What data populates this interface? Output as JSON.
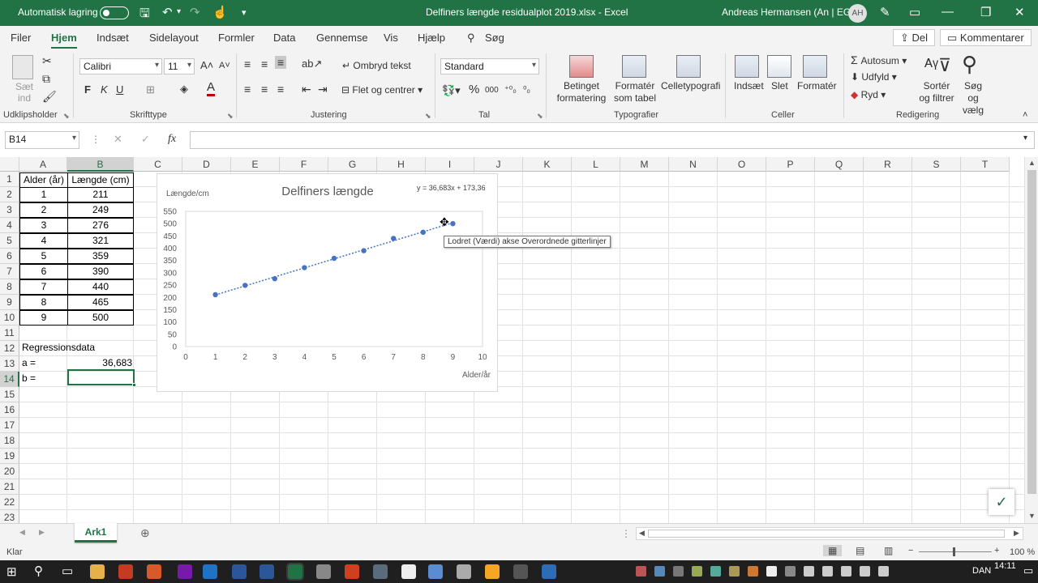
{
  "titlebar": {
    "autosave_label": "Automatisk lagring",
    "doc_title": "Delfiners længde residualplot 2019.xlsx  -  Excel",
    "user_name": "Andreas Hermansen (An | EG)",
    "user_initials": "AH"
  },
  "menu": {
    "tabs": [
      "Filer",
      "Hjem",
      "Indsæt",
      "Sidelayout",
      "Formler",
      "Data",
      "Gennemse",
      "Vis",
      "Hjælp",
      "Søg"
    ],
    "share_label": "Del",
    "comments_label": "Kommentarer"
  },
  "ribbon": {
    "clipboard": {
      "paste": "Sæt ind",
      "group": "Udklipsholder"
    },
    "font": {
      "name": "Calibri",
      "size": "11",
      "group": "Skrifttype",
      "bold": "F",
      "italic": "K",
      "underline": "U"
    },
    "alignment": {
      "wrap": "Ombryd tekst",
      "merge": "Flet og centrer",
      "group": "Justering"
    },
    "number": {
      "format": "Standard",
      "group": "Tal",
      "percent": "%",
      "thousands": "000"
    },
    "styles": {
      "conditional": "Betinget formatering",
      "table": "Formatér som tabel",
      "cellstyles": "Celletypografi",
      "group": "Typografier"
    },
    "cells": {
      "insert": "Indsæt",
      "delete": "Slet",
      "format": "Formatér",
      "group": "Celler"
    },
    "editing": {
      "autosum": "Autosum",
      "fill": "Udfyld",
      "clear": "Ryd",
      "sort": "Sortér og filtrer",
      "find": "Søg og vælg",
      "group": "Redigering"
    }
  },
  "formula_bar": {
    "name_box": "B14",
    "fx": "fx",
    "value": ""
  },
  "grid": {
    "columns": [
      "A",
      "B",
      "C",
      "D",
      "E",
      "F",
      "G",
      "H",
      "I",
      "J",
      "K",
      "L",
      "M",
      "N",
      "O",
      "P",
      "Q",
      "R",
      "S",
      "T"
    ],
    "rows": [
      "1",
      "2",
      "3",
      "4",
      "5",
      "6",
      "7",
      "8",
      "9",
      "10",
      "11",
      "12",
      "13",
      "14",
      "15",
      "16",
      "17",
      "18",
      "19",
      "20",
      "21",
      "22",
      "23"
    ],
    "table_headers": [
      "Alder (år)",
      "Længde (cm)"
    ],
    "table_rows": [
      [
        "1",
        "211"
      ],
      [
        "2",
        "249"
      ],
      [
        "3",
        "276"
      ],
      [
        "4",
        "321"
      ],
      [
        "5",
        "359"
      ],
      [
        "6",
        "390"
      ],
      [
        "7",
        "440"
      ],
      [
        "8",
        "465"
      ],
      [
        "9",
        "500"
      ]
    ],
    "regression_title": "Regressionsdata",
    "a_label": "a =",
    "a_value": "36,683",
    "b_label": "b =",
    "b_value": ""
  },
  "chart_data": {
    "type": "scatter",
    "title": "Delfiners længde",
    "xlabel": "Alder/år",
    "ylabel": "Længde/cm",
    "trendline_label": "y = 36,683x + 173,36",
    "x": [
      1,
      2,
      3,
      4,
      5,
      6,
      7,
      8,
      9
    ],
    "y": [
      211,
      249,
      276,
      321,
      359,
      390,
      440,
      465,
      500
    ],
    "xlim": [
      0,
      10
    ],
    "ylim": [
      0,
      550
    ],
    "xticks": [
      "0",
      "1",
      "2",
      "3",
      "4",
      "5",
      "6",
      "7",
      "8",
      "9",
      "10"
    ],
    "yticks": [
      "0",
      "50",
      "100",
      "150",
      "200",
      "250",
      "300",
      "350",
      "400",
      "450",
      "500",
      "550"
    ],
    "grid": false,
    "trendline": "linear",
    "series_color": "#4472c4",
    "tooltip": "Lodret (Værdi) akse Overordnede gitterlinjer"
  },
  "sheet_tabs": {
    "active": "Ark1"
  },
  "status": {
    "ready": "Klar",
    "zoom": "100 %"
  },
  "taskbar": {
    "lang": "DAN",
    "time": "14:11"
  }
}
